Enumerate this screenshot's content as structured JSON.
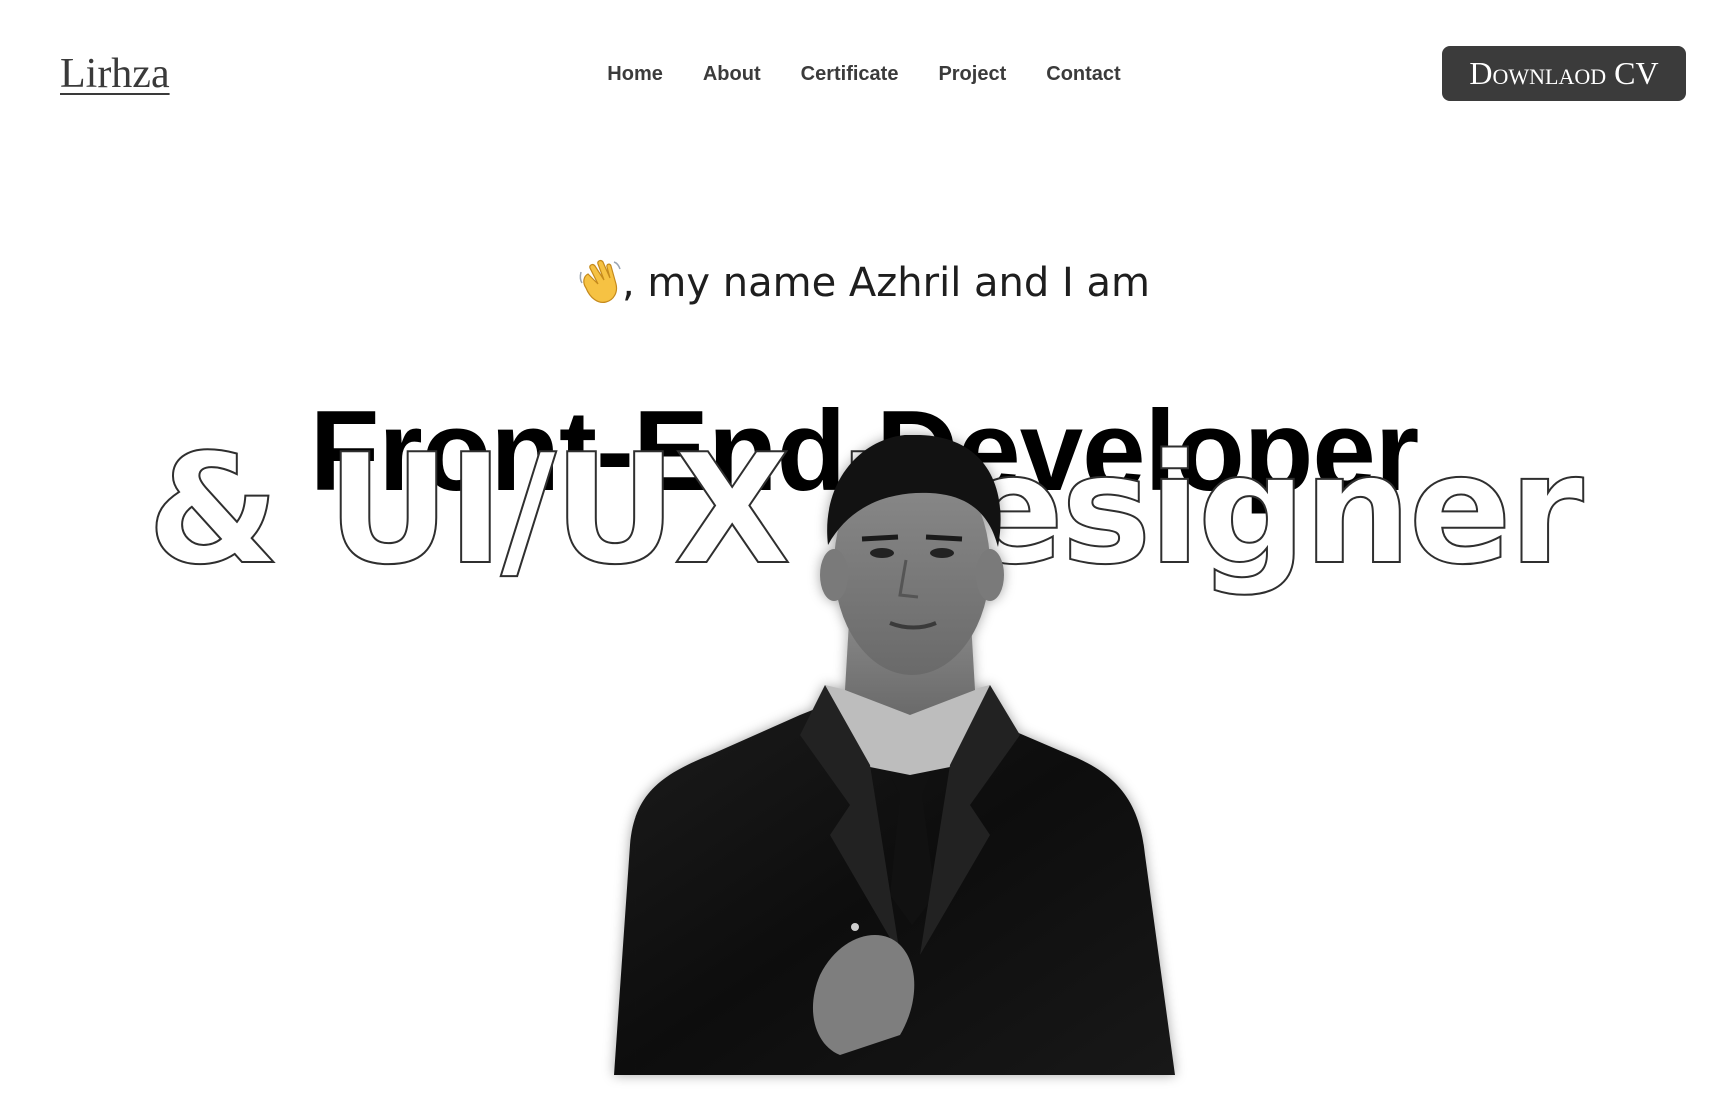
{
  "brand": {
    "logo_text": "Lirhza"
  },
  "nav": {
    "items": [
      {
        "label": "Home"
      },
      {
        "label": "About"
      },
      {
        "label": "Certificate"
      },
      {
        "label": "Project"
      },
      {
        "label": "Contact"
      }
    ]
  },
  "cta": {
    "download_label": "Downlaod CV"
  },
  "hero": {
    "greeting_icon": "waving-hand-icon",
    "greeting_text": ", my name Azhril and I am",
    "headline_line1": "Front-End Developer",
    "headline_line2": "& UI/UX Designer",
    "photo_icon": "portrait-photo"
  },
  "colors": {
    "background": "#ffffff",
    "text_dark": "#000000",
    "nav_text": "#3b3b3b",
    "button_bg": "#3b3b3b",
    "button_text": "#ffffff",
    "outline_stroke": "#2f2f2f"
  }
}
